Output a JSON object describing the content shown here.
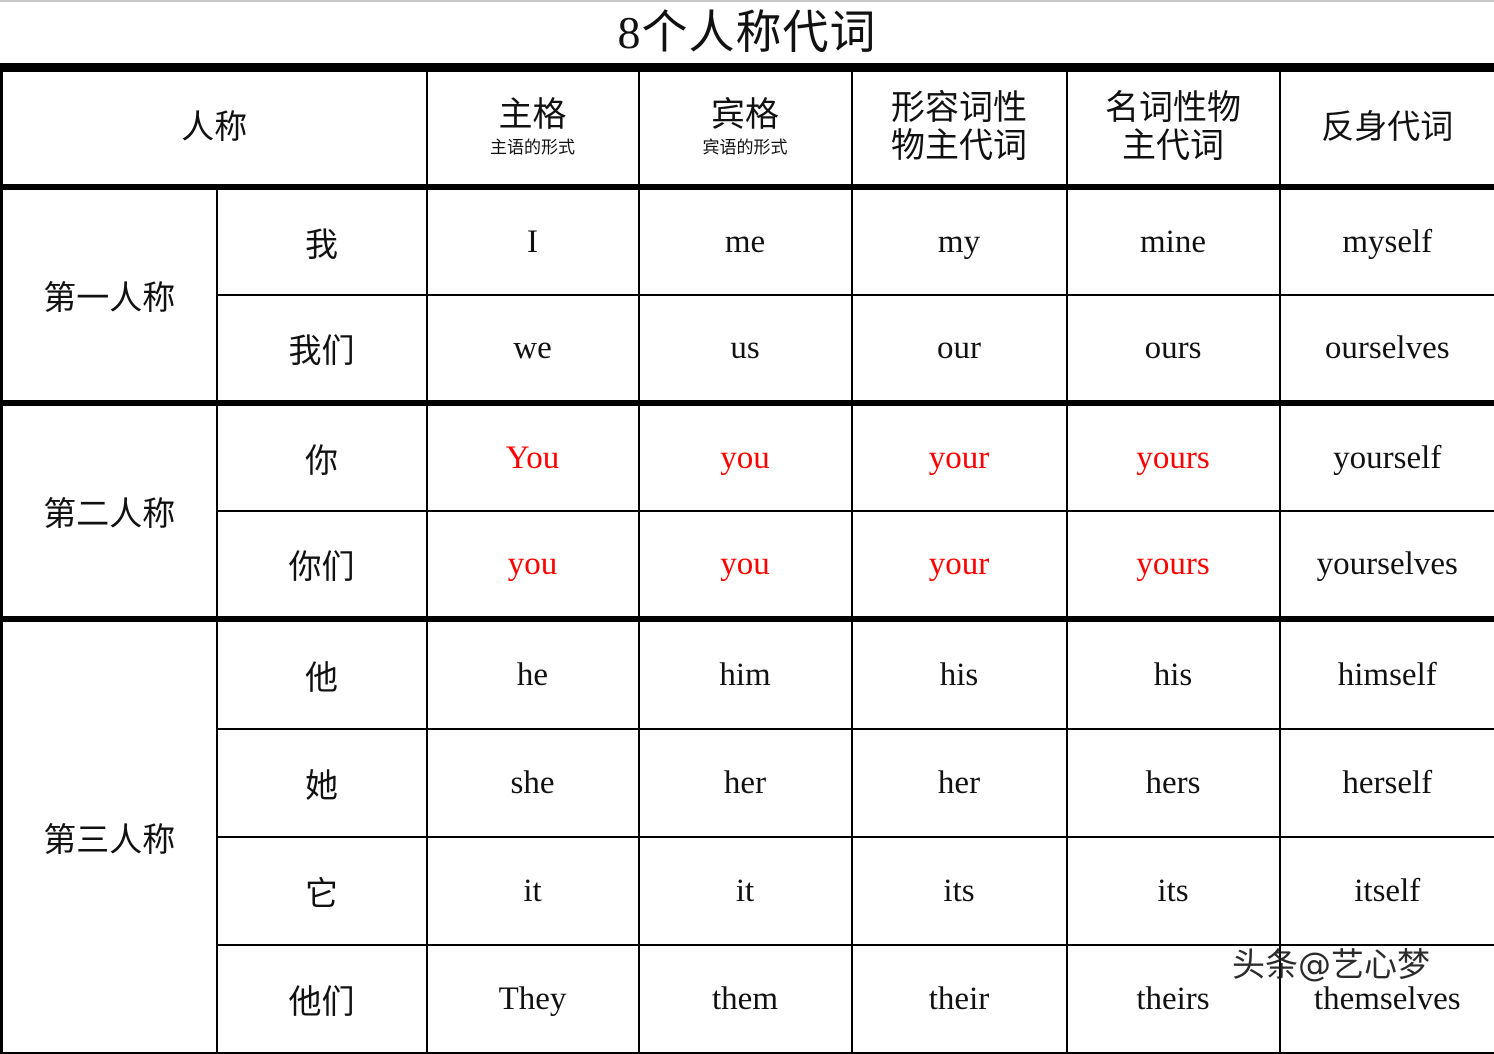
{
  "title": "8个人称代词",
  "columns": {
    "person": "人称",
    "subject": {
      "main": "主格",
      "sub": "主语的形式"
    },
    "object": {
      "main": "宾格",
      "sub": "宾语的形式"
    },
    "possessive_adj": "形容词性\n物主代词",
    "possessive_adj_line1": "形容词性",
    "possessive_adj_line2": "物主代词",
    "possessive_noun_line1": "名词性物",
    "possessive_noun_line2": "主代词",
    "reflexive": "反身代词"
  },
  "groups": [
    {
      "label": "第一人称",
      "rows": 2
    },
    {
      "label": "第二人称",
      "rows": 2
    },
    {
      "label": "第三人称",
      "rows": 4
    }
  ],
  "rows": [
    {
      "person_group": "第一人称",
      "pronoun_cn": "我",
      "subject": "I",
      "object": "me",
      "possessive_adj": "my",
      "possessive_noun": "mine",
      "reflexive": "myself",
      "red": false
    },
    {
      "person_group": "第一人称",
      "pronoun_cn": "我们",
      "subject": "we",
      "object": "us",
      "possessive_adj": "our",
      "possessive_noun": "ours",
      "reflexive": "ourselves",
      "red": false
    },
    {
      "person_group": "第二人称",
      "pronoun_cn": "你",
      "subject": "You",
      "object": "you",
      "possessive_adj": "your",
      "possessive_noun": "yours",
      "reflexive": "yourself",
      "red": true
    },
    {
      "person_group": "第二人称",
      "pronoun_cn": "你们",
      "subject": "you",
      "object": "you",
      "possessive_adj": "your",
      "possessive_noun": "yours",
      "reflexive": "yourselves",
      "red": true
    },
    {
      "person_group": "第三人称",
      "pronoun_cn": "他",
      "subject": "he",
      "object": "him",
      "possessive_adj": "his",
      "possessive_noun": "his",
      "reflexive": "himself",
      "red": false
    },
    {
      "person_group": "第三人称",
      "pronoun_cn": "她",
      "subject": "she",
      "object": "her",
      "possessive_adj": "her",
      "possessive_noun": "hers",
      "reflexive": "herself",
      "red": false
    },
    {
      "person_group": "第三人称",
      "pronoun_cn": "它",
      "subject": "it",
      "object": "it",
      "possessive_adj": "its",
      "possessive_noun": "its",
      "reflexive": "itself",
      "red": false
    },
    {
      "person_group": "第三人称",
      "pronoun_cn": "他们",
      "subject": "They",
      "object": "them",
      "possessive_adj": "their",
      "possessive_noun": "theirs",
      "reflexive": "themselves",
      "red": false
    }
  ],
  "watermark": "头条@艺心梦",
  "colors": {
    "highlight": "#ff0000",
    "text": "#111111",
    "border": "#000000"
  }
}
